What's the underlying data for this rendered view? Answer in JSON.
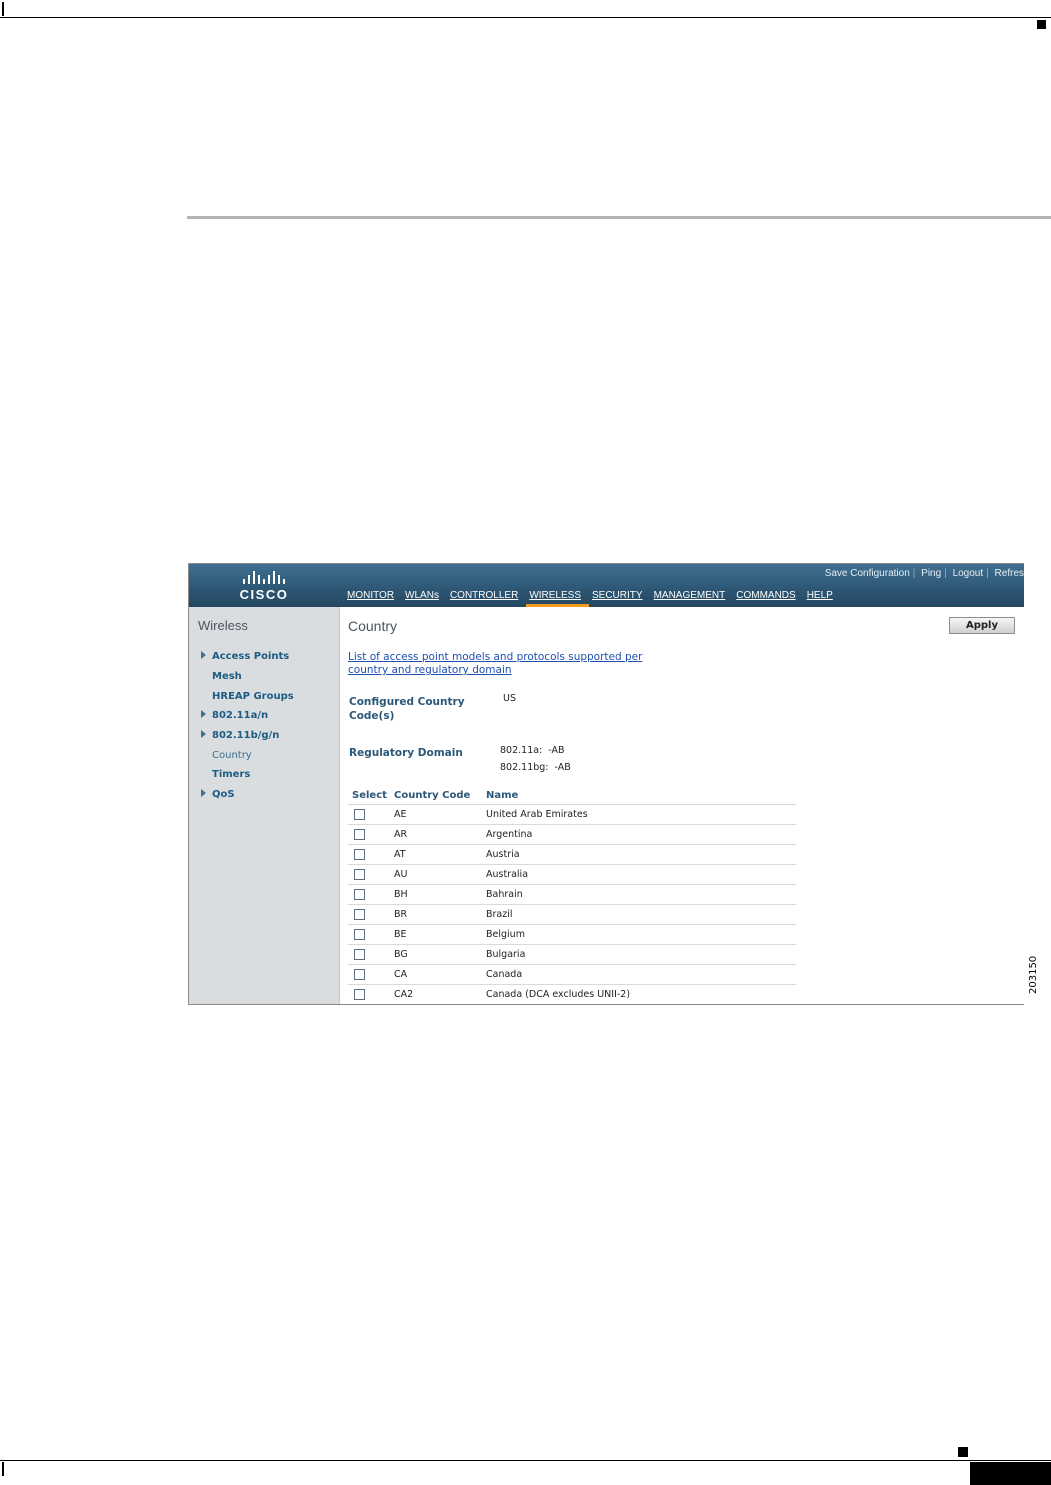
{
  "figure_number": "203150",
  "app": {
    "brand": "CISCO",
    "top_links": [
      "Save Configuration",
      "Ping",
      "Logout",
      "Refres"
    ],
    "nav": [
      "MONITOR",
      "WLANs",
      "CONTROLLER",
      "WIRELESS",
      "SECURITY",
      "MANAGEMENT",
      "COMMANDS",
      "HELP"
    ],
    "active_nav": "WIRELESS",
    "accent_color": "#f29a1d"
  },
  "sidebar": {
    "title": "Wireless",
    "items": [
      {
        "label": "Access Points",
        "expandable": true
      },
      {
        "label": "Mesh",
        "expandable": false
      },
      {
        "label": "HREAP Groups",
        "expandable": false
      },
      {
        "label": "802.11a/n",
        "expandable": true
      },
      {
        "label": "802.11b/g/n",
        "expandable": true
      },
      {
        "label": "Country",
        "expandable": false
      },
      {
        "label": "Timers",
        "expandable": false
      },
      {
        "label": "QoS",
        "expandable": true
      }
    ]
  },
  "main": {
    "title": "Country",
    "apply_label": "Apply",
    "link_text": "List of access point models and protocols supported per country and regulatory domain",
    "configured_label": "Configured Country Code(s)",
    "configured_value": "US",
    "regulatory_label": "Regulatory Domain",
    "regulatory_values": [
      "802.11a:  -AB",
      "802.11bg:  -AB"
    ],
    "table": {
      "headers": [
        "Select",
        "Country Code",
        "Name"
      ],
      "rows": [
        {
          "code": "AE",
          "name": "United Arab Emirates"
        },
        {
          "code": "AR",
          "name": "Argentina"
        },
        {
          "code": "AT",
          "name": "Austria"
        },
        {
          "code": "AU",
          "name": "Australia"
        },
        {
          "code": "BH",
          "name": "Bahrain"
        },
        {
          "code": "BR",
          "name": "Brazil"
        },
        {
          "code": "BE",
          "name": "Belgium"
        },
        {
          "code": "BG",
          "name": "Bulgaria"
        },
        {
          "code": "CA",
          "name": "Canada"
        },
        {
          "code": "CA2",
          "name": "Canada (DCA excludes UNII-2)"
        }
      ]
    }
  }
}
